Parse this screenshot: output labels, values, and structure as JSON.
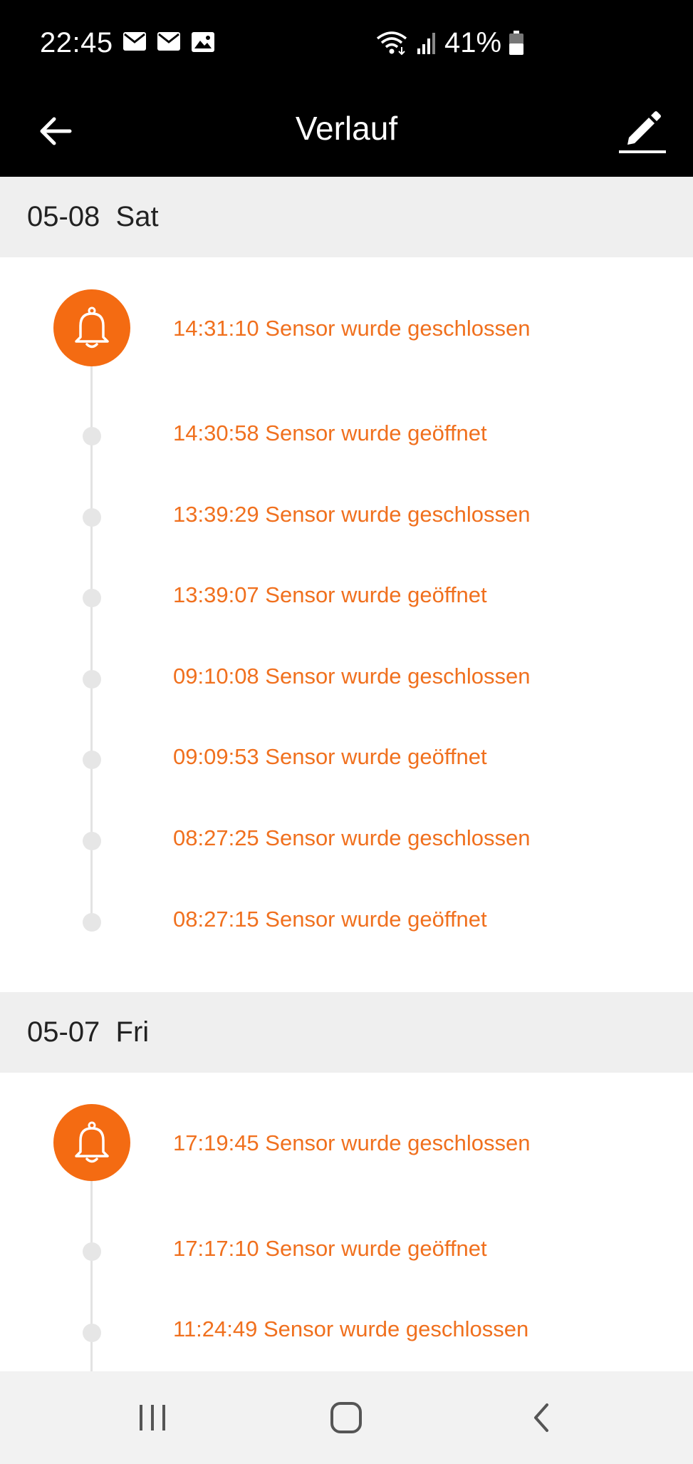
{
  "status_bar": {
    "time": "22:45",
    "battery_percent": "41%",
    "notification_icons": [
      "mail-icon",
      "mail-icon",
      "image-icon"
    ],
    "system_icons": [
      "wifi-icon",
      "signal-icon",
      "battery-icon"
    ]
  },
  "app_bar": {
    "title": "Verlauf",
    "back_icon": "arrow-left-icon",
    "edit_icon": "pencil-icon"
  },
  "colors": {
    "accent": "#f46b12",
    "event_text": "#f0701e",
    "date_header_bg": "#efefef",
    "bar_bg": "#000000"
  },
  "days": [
    {
      "date": "05-08",
      "weekday": "Sat",
      "events": [
        {
          "time": "14:31:10",
          "message": "Sensor wurde geschlossen",
          "text": "14:31:10 Sensor wurde geschlossen",
          "marker": "bell-icon"
        },
        {
          "time": "14:30:58",
          "message": "Sensor wurde geöffnet",
          "text": "14:30:58 Sensor wurde geöffnet",
          "marker": "dot"
        },
        {
          "time": "13:39:29",
          "message": "Sensor wurde geschlossen",
          "text": "13:39:29 Sensor wurde geschlossen",
          "marker": "dot"
        },
        {
          "time": "13:39:07",
          "message": "Sensor wurde geöffnet",
          "text": "13:39:07 Sensor wurde geöffnet",
          "marker": "dot"
        },
        {
          "time": "09:10:08",
          "message": "Sensor wurde geschlossen",
          "text": "09:10:08 Sensor wurde geschlossen",
          "marker": "dot"
        },
        {
          "time": "09:09:53",
          "message": "Sensor wurde geöffnet",
          "text": "09:09:53 Sensor wurde geöffnet",
          "marker": "dot"
        },
        {
          "time": "08:27:25",
          "message": "Sensor wurde geschlossen",
          "text": "08:27:25 Sensor wurde geschlossen",
          "marker": "dot"
        },
        {
          "time": "08:27:15",
          "message": "Sensor wurde geöffnet",
          "text": "08:27:15 Sensor wurde geöffnet",
          "marker": "dot"
        }
      ]
    },
    {
      "date": "05-07",
      "weekday": "Fri",
      "events": [
        {
          "time": "17:19:45",
          "message": "Sensor wurde geschlossen",
          "text": "17:19:45 Sensor wurde geschlossen",
          "marker": "bell-icon"
        },
        {
          "time": "17:17:10",
          "message": "Sensor wurde geöffnet",
          "text": "17:17:10 Sensor wurde geöffnet",
          "marker": "dot"
        },
        {
          "time": "11:24:49",
          "message": "Sensor wurde geschlossen",
          "text": "11:24:49 Sensor wurde geschlossen",
          "marker": "dot"
        }
      ]
    }
  ],
  "nav_bar": {
    "buttons": [
      "recent-apps-icon",
      "home-icon",
      "back-chevron-icon"
    ]
  }
}
